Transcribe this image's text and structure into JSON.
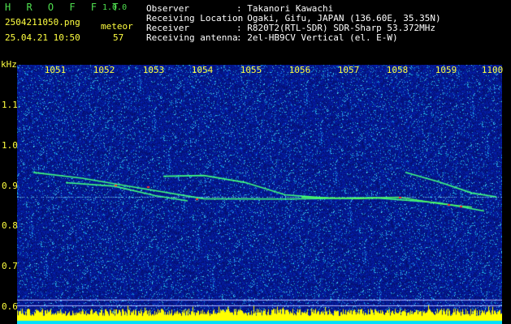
{
  "header": {
    "app_title": "H R O F F T",
    "version": "1.0.0",
    "filename": "2504211050.png",
    "datetime": "25.04.21 10:50",
    "meteor_label": "meteor",
    "meteor_count": "57"
  },
  "info": {
    "observer_label": "Observer",
    "observer_value": ": Takanori Kawachi",
    "location_label": "Receiving Location",
    "location_value": ": Ogaki, Gifu, JAPAN (136.60E, 35.35N)",
    "receiver_label": "Receiver",
    "receiver_value": ": R820T2(RTL-SDR) SDR-Sharp 53.372MHz",
    "antenna_label": "Receiving antenna",
    "antenna_value": ": 2el-HB9CV Vertical (el. E-W)"
  },
  "axes": {
    "y_unit": "kHz",
    "x_ticks": [
      "1051",
      "1052",
      "1053",
      "1054",
      "1055",
      "1056",
      "1057",
      "1058",
      "1059",
      "1100"
    ],
    "y_ticks": [
      "1.1",
      "1.0",
      "0.9",
      "0.8",
      "0.7",
      "0.6"
    ]
  },
  "colors": {
    "background": "#000000",
    "noise_blue": "#0a1e8c",
    "text_yellow": "#ffff40",
    "title_green": "#4fe04f",
    "trail_green": "#40ff80",
    "trail_red": "#ff3030",
    "level_bar": "#ffff00",
    "level_base": "#00e0ff"
  }
}
